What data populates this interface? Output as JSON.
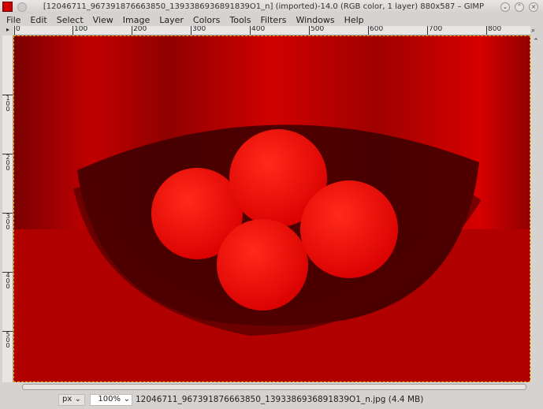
{
  "window": {
    "title": "[12046711_967391876663850_1393386936891839O1_n] (imported)-14.0 (RGB color, 1 layer) 880x587 – GIMP"
  },
  "menu": [
    "File",
    "Edit",
    "Select",
    "View",
    "Image",
    "Layer",
    "Colors",
    "Tools",
    "Filters",
    "Windows",
    "Help"
  ],
  "ruler": {
    "h": [
      "0",
      "100",
      "200",
      "300",
      "400",
      "500",
      "600",
      "700",
      "800"
    ],
    "v": [
      "100",
      "200",
      "300",
      "400",
      "500"
    ]
  },
  "status": {
    "unit": "px",
    "zoom": "100%",
    "file": "12046711_967391876663850_1393386936891839O1_n.jpg (4.4 MB)"
  },
  "colors": {
    "image_tint": "#cc0000"
  }
}
